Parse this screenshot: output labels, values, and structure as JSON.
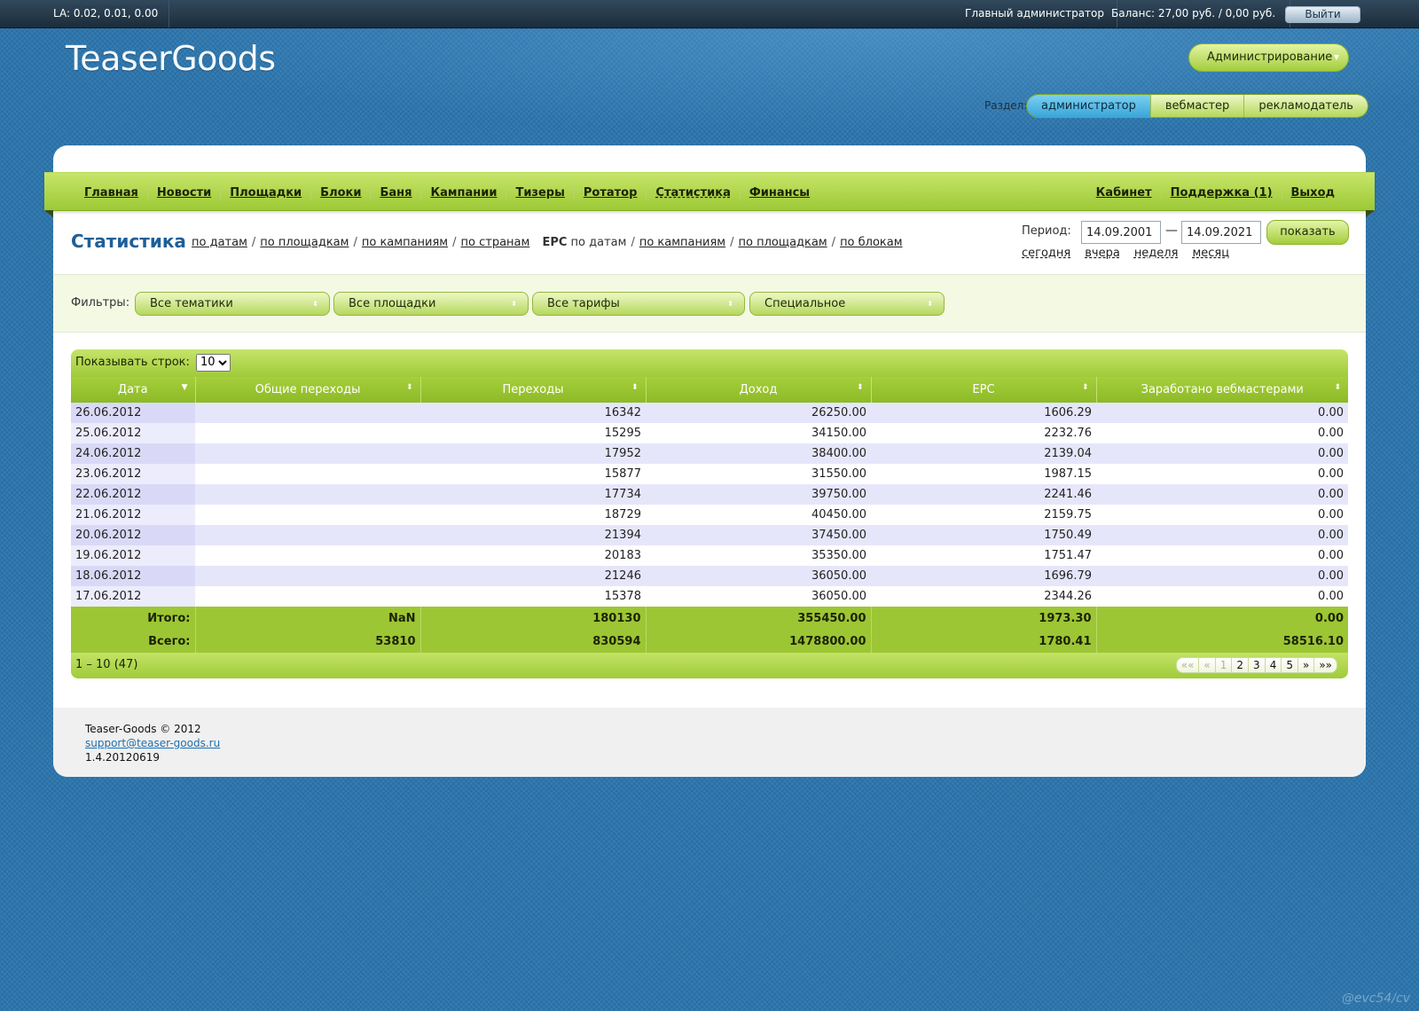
{
  "topbar": {
    "la": "LA: 0.02, 0.01, 0.00",
    "admin": "Главный администратор",
    "balance": "Баланс: 27,00 руб. / 0,00 руб.",
    "logout": "Выйти"
  },
  "logo": "TeaserGoods",
  "admin_menu": "Администрирование",
  "section": {
    "label": "Раздел:",
    "items": [
      "администратор",
      "вебмастер",
      "рекламодатель"
    ]
  },
  "nav": {
    "left": [
      "Главная",
      "Новости",
      "Площадки",
      "Блоки",
      "Баня",
      "Кампании",
      "Тизеры",
      "Ротатор",
      "Статистика",
      "Финансы"
    ],
    "right": [
      "Кабинет",
      "Поддержка (1)",
      "Выход"
    ]
  },
  "stats": {
    "title": "Статистика",
    "links": [
      "по датам",
      "по площадкам",
      "по кампаниям",
      "по странам"
    ],
    "epc_label": "EPC",
    "epc_static": "по датам",
    "epc_links": [
      "по кампаниям",
      "по площадкам",
      "по блокам"
    ]
  },
  "period": {
    "label": "Период:",
    "from": "14.09.2001",
    "to": "14.09.2021",
    "dash": "—",
    "show": "показать",
    "quick": [
      "сегодня",
      "вчера",
      "неделя",
      "месяц"
    ]
  },
  "filters": {
    "label": "Фильтры:",
    "selects": [
      "Все тематики",
      "Все площадки",
      "Все тарифы",
      "Специальное"
    ]
  },
  "grid": {
    "rows_label": "Показывать строк:",
    "rows_value": "10",
    "columns": [
      "Дата",
      "Общие переходы",
      "Переходы",
      "Доход",
      "EPC",
      "Заработано вебмастерами"
    ],
    "rows": [
      [
        "26.06.2012",
        "",
        "16342",
        "26250.00",
        "1606.29",
        "0.00"
      ],
      [
        "25.06.2012",
        "",
        "15295",
        "34150.00",
        "2232.76",
        "0.00"
      ],
      [
        "24.06.2012",
        "",
        "17952",
        "38400.00",
        "2139.04",
        "0.00"
      ],
      [
        "23.06.2012",
        "",
        "15877",
        "31550.00",
        "1987.15",
        "0.00"
      ],
      [
        "22.06.2012",
        "",
        "17734",
        "39750.00",
        "2241.46",
        "0.00"
      ],
      [
        "21.06.2012",
        "",
        "18729",
        "40450.00",
        "2159.75",
        "0.00"
      ],
      [
        "20.06.2012",
        "",
        "21394",
        "37450.00",
        "1750.49",
        "0.00"
      ],
      [
        "19.06.2012",
        "",
        "20183",
        "35350.00",
        "1751.47",
        "0.00"
      ],
      [
        "18.06.2012",
        "",
        "21246",
        "36050.00",
        "1696.79",
        "0.00"
      ],
      [
        "17.06.2012",
        "",
        "15378",
        "36050.00",
        "2344.26",
        "0.00"
      ]
    ],
    "totals": [
      [
        "Итого:",
        "NaN",
        "180130",
        "355450.00",
        "1973.30",
        "0.00"
      ],
      [
        "Всего:",
        "53810",
        "830594",
        "1478800.00",
        "1780.41",
        "58516.10"
      ]
    ],
    "range": "1 – 10 (47)",
    "pager": [
      "««",
      "«",
      "1",
      "2",
      "3",
      "4",
      "5",
      "»",
      "»»"
    ]
  },
  "footer": {
    "copyright": "Teaser-Goods © 2012",
    "email": "support@teaser-goods.ru",
    "version": "1.4.20120619"
  },
  "watermark": "@evc54/cv"
}
